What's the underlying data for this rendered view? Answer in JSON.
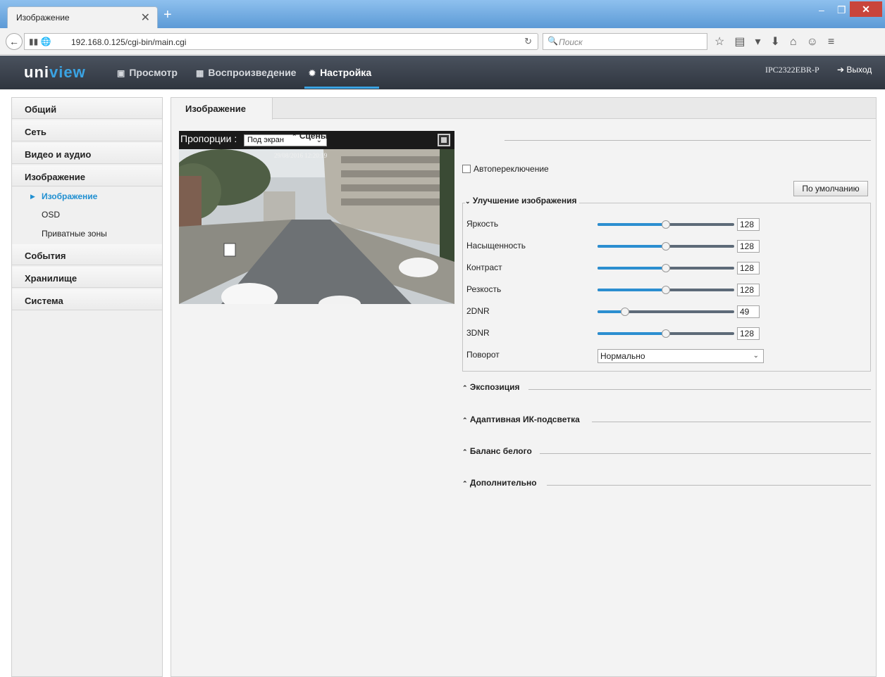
{
  "browser": {
    "tab_title": "Изображение",
    "url": "192.168.0.125/cgi-bin/main.cgi",
    "search_placeholder": "Поиск"
  },
  "header": {
    "logo_a": "uni",
    "logo_b": "view",
    "nav": [
      {
        "label": "Просмотр",
        "icon": "monitor-icon"
      },
      {
        "label": "Воспроизведение",
        "icon": "film-icon"
      },
      {
        "label": "Настройка",
        "icon": "gear-icon"
      }
    ],
    "model": "IPC2322EBR-P",
    "logout": "Выход"
  },
  "sidebar": {
    "items": [
      "Общий",
      "Сеть",
      "Видео и аудио",
      "Изображение",
      "События",
      "Хранилище",
      "Система"
    ],
    "subitems": [
      {
        "label": "Изображение",
        "active": true
      },
      {
        "label": "OSD",
        "active": false
      },
      {
        "label": "Приватные зоны",
        "active": false
      }
    ]
  },
  "main": {
    "tab": "Изображение",
    "preview": {
      "proportion_label": "Пропорции :",
      "proportion_value": "Под экран",
      "timestamp": "29/08/2016 12:20:19"
    },
    "sections": {
      "scenes": "Сцены",
      "auto_switch": "Автопереключение",
      "default_button": "По умолчанию",
      "enhancement": "Улучшение изображения",
      "exposure": "Экспозиция",
      "ir": "Адаптивная ИК-подсветка",
      "wb": "Баланс белого",
      "advanced": "Дополнительно"
    },
    "sliders": [
      {
        "label": "Яркость",
        "value": "128",
        "fraction": 0.5
      },
      {
        "label": "Насыщенность",
        "value": "128",
        "fraction": 0.5
      },
      {
        "label": "Контраст",
        "value": "128",
        "fraction": 0.5
      },
      {
        "label": "Резкость",
        "value": "128",
        "fraction": 0.5
      },
      {
        "label": "2DNR",
        "value": "49",
        "fraction": 0.19
      },
      {
        "label": "3DNR",
        "value": "128",
        "fraction": 0.5
      }
    ],
    "rotation_label": "Поворот",
    "rotation_value": "Нормально"
  }
}
